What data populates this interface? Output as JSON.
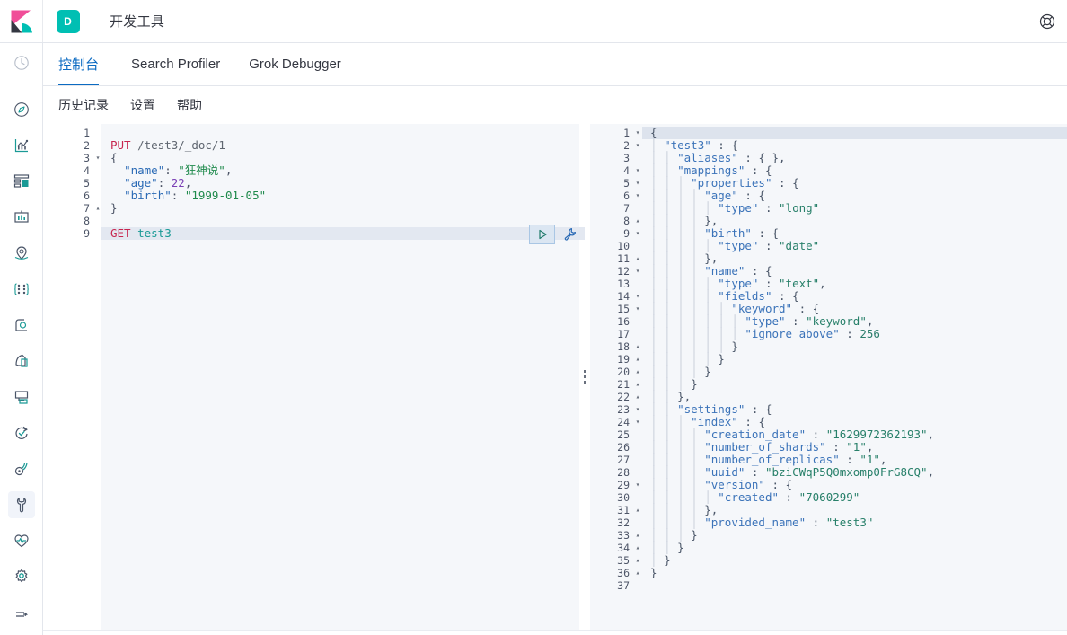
{
  "header": {
    "logo_icon": "kibana-logo",
    "space_badge": "D",
    "app_title": "开发工具",
    "help_icon": "lifebuoy-help-icon"
  },
  "nav_rail": {
    "top_item": {
      "icon": "recently-viewed-clock-icon",
      "name": "recently-viewed"
    },
    "items": [
      {
        "icon": "discover-compass-icon",
        "name": "discover"
      },
      {
        "icon": "visualize-chart-icon",
        "name": "visualize"
      },
      {
        "icon": "dashboard-panels-icon",
        "name": "dashboard"
      },
      {
        "icon": "canvas-presentation-icon",
        "name": "canvas"
      },
      {
        "icon": "maps-location-icon",
        "name": "maps"
      },
      {
        "icon": "machine-learning-nodes-icon",
        "name": "machine-learning"
      },
      {
        "icon": "graph-icon",
        "name": "graph"
      },
      {
        "icon": "uptime-pages-icon",
        "name": "uptime"
      },
      {
        "icon": "apm-monitor-icon",
        "name": "apm"
      },
      {
        "icon": "metrics-refresh-icon",
        "name": "metrics"
      },
      {
        "icon": "logs-signal-icon",
        "name": "logs"
      },
      {
        "icon": "dev-tools-wrench-icon",
        "name": "dev-tools",
        "active": true
      },
      {
        "icon": "stack-monitoring-heart-icon",
        "name": "stack-monitoring"
      },
      {
        "icon": "management-gear-icon",
        "name": "management"
      }
    ],
    "bottom_item": {
      "icon": "collapse-nav-arrow-icon",
      "name": "collapse-navigation"
    }
  },
  "tabs": [
    {
      "label": "控制台",
      "active": true
    },
    {
      "label": "Search Profiler",
      "active": false
    },
    {
      "label": "Grok Debugger",
      "active": false
    }
  ],
  "submenu": [
    {
      "label": "历史记录"
    },
    {
      "label": "设置"
    },
    {
      "label": "帮助"
    }
  ],
  "editor": {
    "active_line": 9,
    "cursor_line": 9,
    "lines": [
      {
        "n": "1",
        "fold": "",
        "tokens": []
      },
      {
        "n": "2",
        "fold": "",
        "tokens": [
          {
            "t": "PUT",
            "c": "t-method"
          },
          {
            "t": " ",
            "c": "t-punc"
          },
          {
            "t": "/test3/_doc/1",
            "c": "t-url"
          }
        ]
      },
      {
        "n": "3",
        "fold": "▾",
        "tokens": [
          {
            "t": "{",
            "c": "t-punc"
          }
        ]
      },
      {
        "n": "4",
        "fold": "",
        "tokens": [
          {
            "t": "  ",
            "c": "t-punc"
          },
          {
            "t": "\"name\"",
            "c": "t-key"
          },
          {
            "t": ": ",
            "c": "t-punc"
          },
          {
            "t": "\"狂神说\"",
            "c": "t-str"
          },
          {
            "t": ",",
            "c": "t-punc"
          }
        ]
      },
      {
        "n": "5",
        "fold": "",
        "tokens": [
          {
            "t": "  ",
            "c": "t-punc"
          },
          {
            "t": "\"age\"",
            "c": "t-key"
          },
          {
            "t": ": ",
            "c": "t-punc"
          },
          {
            "t": "22",
            "c": "t-num"
          },
          {
            "t": ",",
            "c": "t-punc"
          }
        ]
      },
      {
        "n": "6",
        "fold": "",
        "tokens": [
          {
            "t": "  ",
            "c": "t-punc"
          },
          {
            "t": "\"birth\"",
            "c": "t-key"
          },
          {
            "t": ": ",
            "c": "t-punc"
          },
          {
            "t": "\"1999-01-05\"",
            "c": "t-str"
          }
        ]
      },
      {
        "n": "7",
        "fold": "▴",
        "tokens": [
          {
            "t": "}",
            "c": "t-punc"
          }
        ]
      },
      {
        "n": "8",
        "fold": "",
        "tokens": []
      },
      {
        "n": "9",
        "fold": "",
        "tokens": [
          {
            "t": "GET",
            "c": "t-method"
          },
          {
            "t": " ",
            "c": "t-punc"
          },
          {
            "t": "test3",
            "c": "t-url2"
          }
        ],
        "cursor": true
      }
    ]
  },
  "actions": {
    "play_button": "send-request-play-button",
    "wrench_button": "request-options-wrench-button"
  },
  "splitter": {
    "name": "pane-splitter-handle",
    "icon": "grip-dots-icon"
  },
  "response": {
    "active_line": 1,
    "lines": [
      {
        "n": "1",
        "fold": "▾",
        "guides": 0,
        "text": "{"
      },
      {
        "n": "2",
        "fold": "▾",
        "guides": 1,
        "text": "\"test3\" : {"
      },
      {
        "n": "3",
        "fold": "",
        "guides": 2,
        "text": "\"aliases\" : { },"
      },
      {
        "n": "4",
        "fold": "▾",
        "guides": 2,
        "text": "\"mappings\" : {"
      },
      {
        "n": "5",
        "fold": "▾",
        "guides": 3,
        "text": "\"properties\" : {"
      },
      {
        "n": "6",
        "fold": "▾",
        "guides": 4,
        "text": "\"age\" : {"
      },
      {
        "n": "7",
        "fold": "",
        "guides": 5,
        "text": "\"type\" : \"long\""
      },
      {
        "n": "8",
        "fold": "▴",
        "guides": 4,
        "text": "},"
      },
      {
        "n": "9",
        "fold": "▾",
        "guides": 4,
        "text": "\"birth\" : {"
      },
      {
        "n": "10",
        "fold": "",
        "guides": 5,
        "text": "\"type\" : \"date\""
      },
      {
        "n": "11",
        "fold": "▴",
        "guides": 4,
        "text": "},"
      },
      {
        "n": "12",
        "fold": "▾",
        "guides": 4,
        "text": "\"name\" : {"
      },
      {
        "n": "13",
        "fold": "",
        "guides": 5,
        "text": "\"type\" : \"text\","
      },
      {
        "n": "14",
        "fold": "▾",
        "guides": 5,
        "text": "\"fields\" : {"
      },
      {
        "n": "15",
        "fold": "▾",
        "guides": 6,
        "text": "\"keyword\" : {"
      },
      {
        "n": "16",
        "fold": "",
        "guides": 7,
        "text": "\"type\" : \"keyword\","
      },
      {
        "n": "17",
        "fold": "",
        "guides": 7,
        "text": "\"ignore_above\" : 256"
      },
      {
        "n": "18",
        "fold": "▴",
        "guides": 6,
        "text": "}"
      },
      {
        "n": "19",
        "fold": "▴",
        "guides": 5,
        "text": "}"
      },
      {
        "n": "20",
        "fold": "▴",
        "guides": 4,
        "text": "}"
      },
      {
        "n": "21",
        "fold": "▴",
        "guides": 3,
        "text": "}"
      },
      {
        "n": "22",
        "fold": "▴",
        "guides": 2,
        "text": "},"
      },
      {
        "n": "23",
        "fold": "▾",
        "guides": 2,
        "text": "\"settings\" : {"
      },
      {
        "n": "24",
        "fold": "▾",
        "guides": 3,
        "text": "\"index\" : {"
      },
      {
        "n": "25",
        "fold": "",
        "guides": 4,
        "text": "\"creation_date\" : \"1629972362193\","
      },
      {
        "n": "26",
        "fold": "",
        "guides": 4,
        "text": "\"number_of_shards\" : \"1\","
      },
      {
        "n": "27",
        "fold": "",
        "guides": 4,
        "text": "\"number_of_replicas\" : \"1\","
      },
      {
        "n": "28",
        "fold": "",
        "guides": 4,
        "text": "\"uuid\" : \"bziCWqP5Q0mxomp0FrG8CQ\","
      },
      {
        "n": "29",
        "fold": "▾",
        "guides": 4,
        "text": "\"version\" : {"
      },
      {
        "n": "30",
        "fold": "",
        "guides": 5,
        "text": "\"created\" : \"7060299\""
      },
      {
        "n": "31",
        "fold": "▴",
        "guides": 4,
        "text": "},"
      },
      {
        "n": "32",
        "fold": "",
        "guides": 4,
        "text": "\"provided_name\" : \"test3\""
      },
      {
        "n": "33",
        "fold": "▴",
        "guides": 3,
        "text": "}"
      },
      {
        "n": "34",
        "fold": "▴",
        "guides": 2,
        "text": "}"
      },
      {
        "n": "35",
        "fold": "▴",
        "guides": 1,
        "text": "}"
      },
      {
        "n": "36",
        "fold": "▴",
        "guides": 0,
        "text": "}"
      },
      {
        "n": "37",
        "fold": "",
        "guides": 0,
        "text": ""
      }
    ]
  },
  "colors": {
    "accent_blue": "#0c6bc2",
    "teal": "#00bfb3",
    "pink": "#f04e98",
    "method": "#c7254e",
    "key": "#2a6ab5",
    "string": "#1f8a4c",
    "number": "#7a3fb5",
    "response_key": "#3b73b9",
    "response_string": "#28806a",
    "pane_bg": "#f5f7fa"
  }
}
